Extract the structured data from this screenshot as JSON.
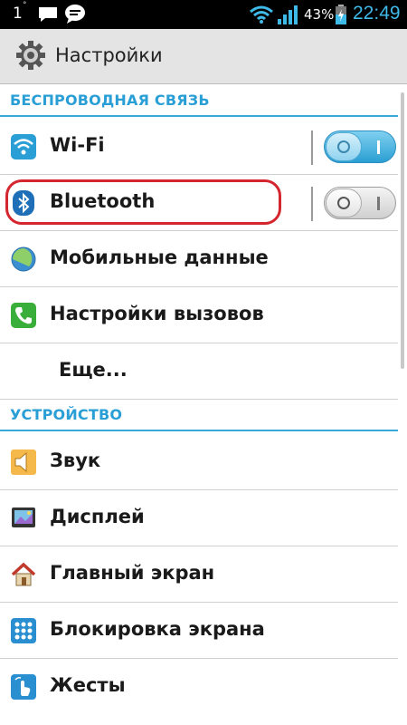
{
  "status_bar": {
    "notification_count": "1",
    "degree": "°",
    "battery_percent": "43%",
    "time": "22:49"
  },
  "action_bar": {
    "title": "Настройки",
    "icon": "gear-icon"
  },
  "sections": {
    "wireless": {
      "header": "БЕСПРОВОДНАЯ СВЯЗЬ",
      "items": [
        {
          "label": "Wi-Fi",
          "icon": "wifi-icon",
          "toggle": "on"
        },
        {
          "label": "Bluetooth",
          "icon": "bluetooth-icon",
          "toggle": "off"
        },
        {
          "label": "Мобильные данные",
          "icon": "mobile-data-icon"
        },
        {
          "label": "Настройки вызовов",
          "icon": "phone-icon"
        },
        {
          "label": "Еще..."
        }
      ]
    },
    "device": {
      "header": "УСТРОЙСТВО",
      "items": [
        {
          "label": "Звук",
          "icon": "speaker-icon"
        },
        {
          "label": "Дисплей",
          "icon": "display-icon"
        },
        {
          "label": "Главный экран",
          "icon": "home-icon"
        },
        {
          "label": "Блокировка экрана",
          "icon": "lock-screen-icon"
        },
        {
          "label": "Жесты",
          "icon": "gesture-icon"
        }
      ]
    }
  },
  "colors": {
    "accent": "#2a9fd6",
    "status_time": "#3fb9e8",
    "highlight": "#d4262f"
  }
}
